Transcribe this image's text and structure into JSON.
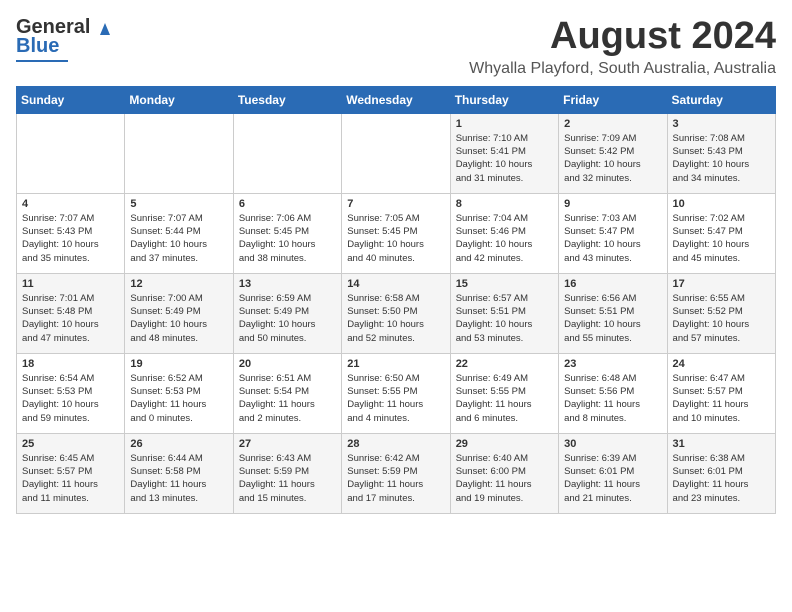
{
  "header": {
    "logo_line1": "General",
    "logo_line2": "Blue",
    "month": "August 2024",
    "location": "Whyalla Playford, South Australia, Australia"
  },
  "days_of_week": [
    "Sunday",
    "Monday",
    "Tuesday",
    "Wednesday",
    "Thursday",
    "Friday",
    "Saturday"
  ],
  "weeks": [
    [
      {
        "day": "",
        "info": ""
      },
      {
        "day": "",
        "info": ""
      },
      {
        "day": "",
        "info": ""
      },
      {
        "day": "",
        "info": ""
      },
      {
        "day": "1",
        "info": "Sunrise: 7:10 AM\nSunset: 5:41 PM\nDaylight: 10 hours\nand 31 minutes."
      },
      {
        "day": "2",
        "info": "Sunrise: 7:09 AM\nSunset: 5:42 PM\nDaylight: 10 hours\nand 32 minutes."
      },
      {
        "day": "3",
        "info": "Sunrise: 7:08 AM\nSunset: 5:43 PM\nDaylight: 10 hours\nand 34 minutes."
      }
    ],
    [
      {
        "day": "4",
        "info": "Sunrise: 7:07 AM\nSunset: 5:43 PM\nDaylight: 10 hours\nand 35 minutes."
      },
      {
        "day": "5",
        "info": "Sunrise: 7:07 AM\nSunset: 5:44 PM\nDaylight: 10 hours\nand 37 minutes."
      },
      {
        "day": "6",
        "info": "Sunrise: 7:06 AM\nSunset: 5:45 PM\nDaylight: 10 hours\nand 38 minutes."
      },
      {
        "day": "7",
        "info": "Sunrise: 7:05 AM\nSunset: 5:45 PM\nDaylight: 10 hours\nand 40 minutes."
      },
      {
        "day": "8",
        "info": "Sunrise: 7:04 AM\nSunset: 5:46 PM\nDaylight: 10 hours\nand 42 minutes."
      },
      {
        "day": "9",
        "info": "Sunrise: 7:03 AM\nSunset: 5:47 PM\nDaylight: 10 hours\nand 43 minutes."
      },
      {
        "day": "10",
        "info": "Sunrise: 7:02 AM\nSunset: 5:47 PM\nDaylight: 10 hours\nand 45 minutes."
      }
    ],
    [
      {
        "day": "11",
        "info": "Sunrise: 7:01 AM\nSunset: 5:48 PM\nDaylight: 10 hours\nand 47 minutes."
      },
      {
        "day": "12",
        "info": "Sunrise: 7:00 AM\nSunset: 5:49 PM\nDaylight: 10 hours\nand 48 minutes."
      },
      {
        "day": "13",
        "info": "Sunrise: 6:59 AM\nSunset: 5:49 PM\nDaylight: 10 hours\nand 50 minutes."
      },
      {
        "day": "14",
        "info": "Sunrise: 6:58 AM\nSunset: 5:50 PM\nDaylight: 10 hours\nand 52 minutes."
      },
      {
        "day": "15",
        "info": "Sunrise: 6:57 AM\nSunset: 5:51 PM\nDaylight: 10 hours\nand 53 minutes."
      },
      {
        "day": "16",
        "info": "Sunrise: 6:56 AM\nSunset: 5:51 PM\nDaylight: 10 hours\nand 55 minutes."
      },
      {
        "day": "17",
        "info": "Sunrise: 6:55 AM\nSunset: 5:52 PM\nDaylight: 10 hours\nand 57 minutes."
      }
    ],
    [
      {
        "day": "18",
        "info": "Sunrise: 6:54 AM\nSunset: 5:53 PM\nDaylight: 10 hours\nand 59 minutes."
      },
      {
        "day": "19",
        "info": "Sunrise: 6:52 AM\nSunset: 5:53 PM\nDaylight: 11 hours\nand 0 minutes."
      },
      {
        "day": "20",
        "info": "Sunrise: 6:51 AM\nSunset: 5:54 PM\nDaylight: 11 hours\nand 2 minutes."
      },
      {
        "day": "21",
        "info": "Sunrise: 6:50 AM\nSunset: 5:55 PM\nDaylight: 11 hours\nand 4 minutes."
      },
      {
        "day": "22",
        "info": "Sunrise: 6:49 AM\nSunset: 5:55 PM\nDaylight: 11 hours\nand 6 minutes."
      },
      {
        "day": "23",
        "info": "Sunrise: 6:48 AM\nSunset: 5:56 PM\nDaylight: 11 hours\nand 8 minutes."
      },
      {
        "day": "24",
        "info": "Sunrise: 6:47 AM\nSunset: 5:57 PM\nDaylight: 11 hours\nand 10 minutes."
      }
    ],
    [
      {
        "day": "25",
        "info": "Sunrise: 6:45 AM\nSunset: 5:57 PM\nDaylight: 11 hours\nand 11 minutes."
      },
      {
        "day": "26",
        "info": "Sunrise: 6:44 AM\nSunset: 5:58 PM\nDaylight: 11 hours\nand 13 minutes."
      },
      {
        "day": "27",
        "info": "Sunrise: 6:43 AM\nSunset: 5:59 PM\nDaylight: 11 hours\nand 15 minutes."
      },
      {
        "day": "28",
        "info": "Sunrise: 6:42 AM\nSunset: 5:59 PM\nDaylight: 11 hours\nand 17 minutes."
      },
      {
        "day": "29",
        "info": "Sunrise: 6:40 AM\nSunset: 6:00 PM\nDaylight: 11 hours\nand 19 minutes."
      },
      {
        "day": "30",
        "info": "Sunrise: 6:39 AM\nSunset: 6:01 PM\nDaylight: 11 hours\nand 21 minutes."
      },
      {
        "day": "31",
        "info": "Sunrise: 6:38 AM\nSunset: 6:01 PM\nDaylight: 11 hours\nand 23 minutes."
      }
    ]
  ]
}
